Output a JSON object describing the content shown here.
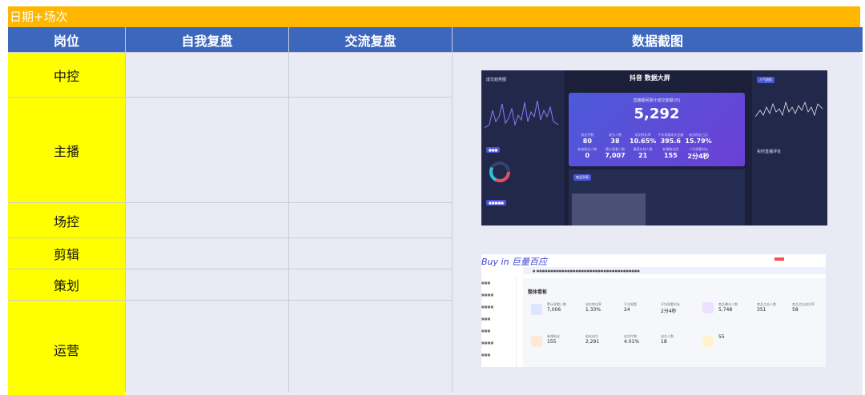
{
  "title": "日期+场次",
  "headers": [
    "岗位",
    "自我复盘",
    "交流复盘",
    "数据截图"
  ],
  "roles": [
    "中控",
    "主播",
    "场控",
    "剪辑",
    "策划",
    "运营"
  ],
  "colors": {
    "title_bar": "#ffb600",
    "header": "#3d67bd",
    "role": "#ffff00",
    "cell": "#e9eaf3"
  },
  "screenshot1": {
    "brand": "抖音 数据大屏",
    "left_title": "成交趋势图",
    "right_tab": "人气趋势",
    "card_caption": "直播期间累计成交金额(元)",
    "gmv": "5,292",
    "kpis": [
      {
        "label": "成交件数",
        "value": "80"
      },
      {
        "label": "成交人数",
        "value": "38"
      },
      {
        "label": "成交转化率",
        "value": "10.65%"
      },
      {
        "label": "千次观看成交金额",
        "value": "395.6"
      },
      {
        "label": "成交粉丝占比",
        "value": "15.79%"
      },
      {
        "label": "",
        "value": ""
      },
      {
        "label": "新加粉丝人数",
        "value": "0"
      },
      {
        "label": "累计观看人数",
        "value": "7,007"
      },
      {
        "label": "最高在线人数",
        "value": "21"
      },
      {
        "label": "新增粉丝团",
        "value": "155"
      },
      {
        "label": "人均观看时长",
        "value": "2分4秒"
      },
      {
        "label": "",
        "value": ""
      }
    ],
    "product_tag": "商品列表",
    "realtime_comment": "实时直播评论"
  },
  "screenshot2": {
    "logo": "Buy in 巨量百应",
    "board_title": "整体看板",
    "metrics": [
      {
        "label": "累计观看人数",
        "value": "7,006"
      },
      {
        "label": "成交转化率",
        "value": "1.33%"
      },
      {
        "label": "千次观看",
        "value": "24"
      },
      {
        "label": "平均观看时长",
        "value": "2分4秒"
      },
      {
        "label": "新增粉丝",
        "value": "155"
      },
      {
        "label": "粉丝成交",
        "value": "2,291"
      },
      {
        "label": "成交件数",
        "value": "4.01%"
      },
      {
        "label": "成交人数",
        "value": "18"
      }
    ],
    "side_metrics": [
      {
        "label": "商品曝光人数",
        "value": "5,748"
      },
      {
        "label": "商品点击人数",
        "value": "351"
      },
      {
        "label": "商品点击成交率",
        "value": "58"
      },
      {
        "label": "",
        "value": "55"
      }
    ]
  }
}
